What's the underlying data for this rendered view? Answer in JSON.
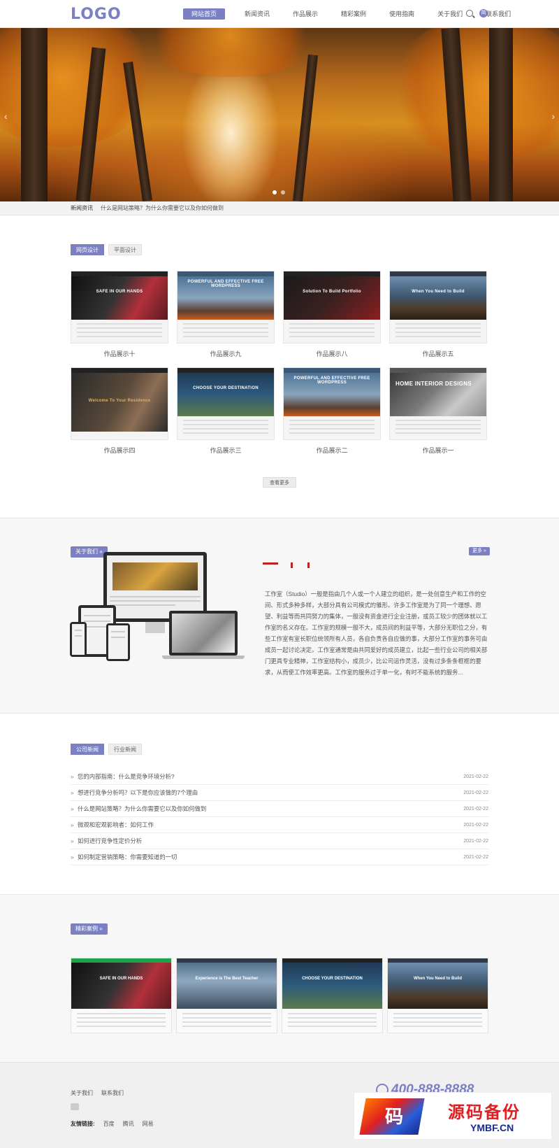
{
  "header": {
    "logo": "LOGO",
    "nav": [
      "网站首页",
      "新闻资讯",
      "作品展示",
      "精彩案例",
      "使用指南",
      "关于我们",
      "联系我们"
    ],
    "lang_icon_text": "简",
    "icons": [
      "search-icon",
      "language-icon"
    ]
  },
  "banner": {
    "arrows": [
      "‹",
      "›"
    ],
    "slides": 2,
    "active_slide": 1
  },
  "ticker": {
    "label": "新闻资讯",
    "text": "什么是网站策略？为什么你需要它以及你如何做到"
  },
  "portfolio": {
    "tabs": [
      "网页设计",
      "平面设计"
    ],
    "items": [
      {
        "title": "作品展示十",
        "hero_text": "SAFE IN OUR HANDS"
      },
      {
        "title": "作品展示九",
        "hero_text": "POWERFUL AND EFFECTIVE FREE WORDPRESS"
      },
      {
        "title": "作品展示八",
        "hero_text": "Solution To Build Portfolio"
      },
      {
        "title": "作品展示五",
        "hero_text": "When You Need to Build"
      },
      {
        "title": "作品展示四",
        "hero_text": "Welcome To Your Residence"
      },
      {
        "title": "作品展示三",
        "hero_text": "CHOOSE YOUR DESTINATION"
      },
      {
        "title": "作品展示二",
        "hero_text": "POWERFUL AND EFFECTIVE FREE WORDPRESS"
      },
      {
        "title": "作品展示一",
        "hero_text": "HOME INTERIOR DESIGNS"
      }
    ],
    "more_label": "查看更多"
  },
  "about": {
    "button": "关于我们 »",
    "more": "更多 »",
    "text": "工作室（Studio）一般是指由几个人或一个人建立的组织，是一处创意生产和工作的空间、形式多种多样，大部分具有公司模式的雏形。许多工作室是为了同一个理想、愿望、利益等而共同努力的集体，一般没有资金进行企业注册，或员工较少的团体就以工作室的名义存在。工作室的规模一般不大，成员间的利益平等，大部分无职位之分，有些工作室有室长职位统领所有人员，各自负责各自应做的事，大部分工作室的事务可由成员一起讨论决定。工作室通常是由共同爱好的成员建立，比起一些行业公司的相关部门更具专业精神，工作室结构小，成员少，比公司运作灵活，没有过多条条框框的要求，从而使工作效率更高。工作室的服务过于单一化，有时不能系统的服务..."
  },
  "news": {
    "tabs": [
      "公司新闻",
      "行业新闻"
    ],
    "items": [
      {
        "title": "您的内部指南：什么是竞争环境分析?",
        "date": "2021-02-22"
      },
      {
        "title": "想进行竞争分析吗？以下是你应该做的7个理由",
        "date": "2021-02-22"
      },
      {
        "title": "什么是网站策略？为什么你需要它以及你如何做到",
        "date": "2021-02-22"
      },
      {
        "title": "微观和宏观影响者：如何工作",
        "date": "2021-02-22"
      },
      {
        "title": "如何进行竞争性定价分析",
        "date": "2021-02-22"
      },
      {
        "title": "如何制定营销策略：你需要知道的一切",
        "date": "2021-02-22"
      }
    ]
  },
  "cases": {
    "button": "精彩案例 »",
    "items": [
      {
        "hero_text": "SAFE IN OUR HANDS"
      },
      {
        "hero_text": "Experience is The Best Teacher"
      },
      {
        "hero_text": "CHOOSE YOUR DESTINATION"
      },
      {
        "hero_text": "When You Need to Build"
      }
    ]
  },
  "footer": {
    "links": [
      "关于我们",
      "联系我们"
    ],
    "friends_label": "友情链接:",
    "friends": [
      "百度",
      "腾讯",
      "网易"
    ],
    "phone": "400-888-8888"
  },
  "watermark": {
    "mark": "码",
    "cn": "源码备份",
    "en": "YMBF.CN"
  },
  "colors": {
    "accent": "#7a80c2",
    "deco_red": "#b22222"
  }
}
